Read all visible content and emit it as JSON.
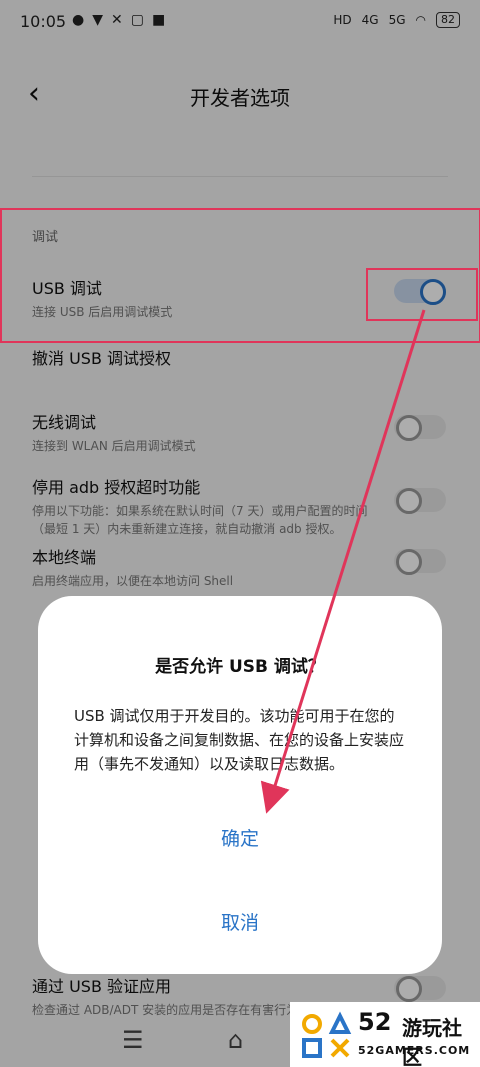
{
  "status_bar": {
    "time": "10:05",
    "left_icons": [
      "app-icon",
      "v-icon",
      "tools-icon",
      "note-icon",
      "flag-icon"
    ],
    "network_hd": "HD",
    "network_4g": "4G",
    "network_5g": "5G",
    "battery": "82"
  },
  "header": {
    "back_icon": "chevron-left-icon",
    "title": "开发者选项"
  },
  "section_debug": "调试",
  "items": [
    {
      "title": "USB 调试",
      "subtitle": "连接 USB 后启用调试模式",
      "toggle": true
    },
    {
      "title": "撤消 USB 调试授权",
      "subtitle": ""
    },
    {
      "title": "无线调试",
      "subtitle": "连接到 WLAN 后启用调试模式",
      "toggle": false
    },
    {
      "title": "停用 adb 授权超时功能",
      "subtitle": "停用以下功能：如果系统在默认时间（7 天）或用户配置的时间（最短 1 天）内未重新建立连接，就自动撤消 adb 授权。",
      "toggle": false
    },
    {
      "title": "本地终端",
      "subtitle": "启用终端应用，以便在本地访问 Shell",
      "toggle": false
    },
    {
      "title": "通过 USB 验证应用",
      "subtitle": "检查通过 ADB/ADT 安装的应用是否存在有害行为",
      "toggle": false
    }
  ],
  "dialog": {
    "title": "是否允许 USB 调试？",
    "body": "USB 调试仅用于开发目的。该功能可用于在您的计算机和设备之间复制数据、在您的设备上安装应用（事先不发通知）以及读取日志数据。",
    "confirm": "确定",
    "cancel": "取消"
  },
  "nav": {
    "menu_icon": "menu-icon",
    "home_icon": "home-icon"
  },
  "watermark": {
    "number": "52",
    "cn": "游玩社区",
    "en": "52GAMERS.COM"
  },
  "colors": {
    "accent": "#2a74c7",
    "annotation": "#e0355a"
  }
}
